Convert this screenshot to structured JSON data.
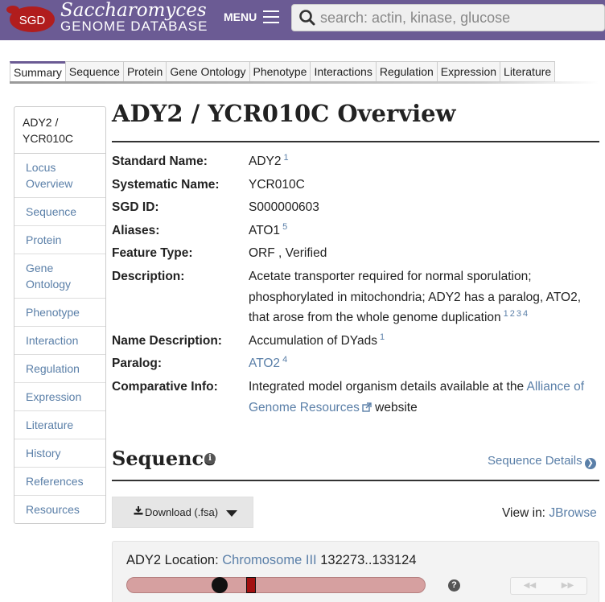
{
  "header": {
    "logo_abbr": "SGD",
    "logo_title": "Saccharomyces",
    "logo_subtitle": "GENOME DATABASE",
    "menu_label": "MENU",
    "search_placeholder": "search: actin, kinase, glucose"
  },
  "tabs": [
    {
      "label": "Summary",
      "active": true
    },
    {
      "label": "Sequence"
    },
    {
      "label": "Protein"
    },
    {
      "label": "Gene Ontology"
    },
    {
      "label": "Phenotype"
    },
    {
      "label": "Interactions"
    },
    {
      "label": "Regulation"
    },
    {
      "label": "Expression"
    },
    {
      "label": "Literature"
    }
  ],
  "sidebar": {
    "heading_line1": "ADY2 /",
    "heading_line2": "YCR010C",
    "items": [
      {
        "line1": "Locus",
        "line2": "Overview"
      },
      {
        "line1": "Sequence"
      },
      {
        "line1": "Protein"
      },
      {
        "line1": "Gene",
        "line2": "Ontology"
      },
      {
        "line1": "Phenotype"
      },
      {
        "line1": "Interaction"
      },
      {
        "line1": "Regulation"
      },
      {
        "line1": "Expression"
      },
      {
        "line1": "Literature"
      },
      {
        "line1": "History"
      },
      {
        "line1": "References"
      },
      {
        "line1": "Resources"
      }
    ]
  },
  "overview": {
    "title": "ADY2 / YCR010C Overview",
    "standard_name_label": "Standard Name:",
    "standard_name": "ADY2",
    "standard_name_ref": "1",
    "systematic_name_label": "Systematic Name:",
    "systematic_name": "YCR010C",
    "sgd_id_label": "SGD ID:",
    "sgd_id": "S000000603",
    "aliases_label": "Aliases:",
    "aliases": "ATO1",
    "aliases_ref": "5",
    "feature_type_label": "Feature Type:",
    "feature_type": "ORF , Verified",
    "description_label": "Description:",
    "description_line1": "Acetate transporter required for normal sporulation;",
    "description_line2": "phosphorylated in mitochondria; ADY2 has a paralog, ATO2,",
    "description_line3": "that arose from the whole genome duplication",
    "description_refs": [
      "1",
      "2",
      "3",
      "4"
    ],
    "name_description_label": "Name Description:",
    "name_description": "Accumulation of DYads",
    "name_description_ref": "1",
    "paralog_label": "Paralog:",
    "paralog": "ATO2",
    "paralog_ref": "4",
    "comparative_label": "Comparative Info:",
    "comparative_pre": "Integrated model organism details available at the",
    "comparative_link_line1": "Alliance of",
    "comparative_link_line2": "Genome Resources",
    "comparative_post": "website"
  },
  "sequence": {
    "title": "Sequence",
    "details_link": "Sequence Details",
    "download_label": "Download (.fsa)",
    "view_in_label": "View in:",
    "view_in_link": "JBrowse",
    "location_label": "ADY2 Location:",
    "chromosome_link": "Chromosome III",
    "coordinates": "132273..133124",
    "help_symbol": "?"
  },
  "colors": {
    "header_purple": "#6b5b94",
    "link_blue": "#5a7fa8",
    "chromosome_fill": "#d6a0a0",
    "locus_red": "#a31010"
  }
}
